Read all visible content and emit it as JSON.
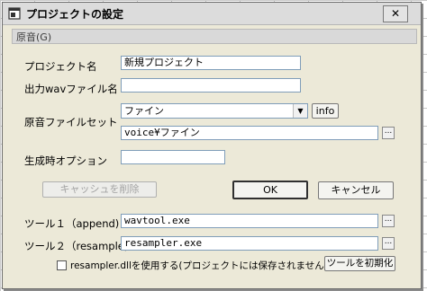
{
  "window": {
    "title": "プロジェクトの設定",
    "close_glyph": "✕"
  },
  "menu": {
    "label": "原音(G)"
  },
  "fields": {
    "project_name_label": "プロジェクト名",
    "project_name_value": "新規プロジェクト",
    "wav_label": "出力wavファイル名",
    "wav_value": "",
    "voiceset_label": "原音ファイルセット",
    "voiceset_selected": "ファイン",
    "voiceset_path": "voice¥ファイン",
    "option_label": "生成時オプション",
    "option_value": ""
  },
  "buttons": {
    "info": "info",
    "browse": "...",
    "clear_cache": "キャッシュを削除",
    "ok": "OK",
    "cancel": "キャンセル",
    "reset_tools": "ツールを初期化"
  },
  "tools": {
    "tool1_label": "ツール１（append)",
    "tool1_value": "wavtool.exe",
    "tool2_label": "ツール２（resample)",
    "tool2_value": "resampler.exe"
  },
  "checkbox": {
    "label": "resampler.dllを使用する(プロジェクトには保存されません)",
    "checked": false
  },
  "icons": {
    "app": "window-app-icon",
    "dropdown": "chevron-down-icon"
  }
}
